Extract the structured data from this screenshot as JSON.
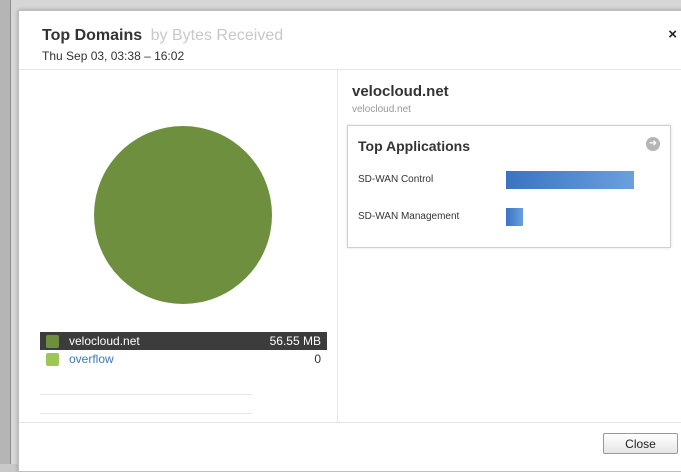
{
  "header": {
    "title": "Top Domains",
    "title_sub": "by Bytes Received",
    "date_range": "Thu Sep 03, 03:38 – 16:02",
    "close_glyph": "×"
  },
  "pie": {
    "slices": [
      {
        "name": "velocloud.net",
        "value_mb": 56.55,
        "color": "#6e8f3e"
      },
      {
        "name": "overflow",
        "value_mb": 0,
        "color": "#9cc65a"
      }
    ]
  },
  "legend": [
    {
      "name": "velocloud.net",
      "value": "56.55 MB",
      "color": "#6e8f3e",
      "selected": true
    },
    {
      "name": "overflow",
      "value": "0",
      "color": "#9cc65a",
      "selected": false
    }
  ],
  "detail": {
    "domain": "velocloud.net",
    "domain_sub": "velocloud.net",
    "apps_title": "Top Applications",
    "arrow_icon": "arrow-right-circle-icon",
    "apps": [
      {
        "name": "SD-WAN Control",
        "relative": 1.0
      },
      {
        "name": "SD-WAN Management",
        "relative": 0.13
      }
    ]
  },
  "footer": {
    "close_label": "Close"
  },
  "colors": {
    "accent_link": "#3a79b8",
    "selected_row": "#3c3c3c",
    "bar": "#3a73c2"
  }
}
